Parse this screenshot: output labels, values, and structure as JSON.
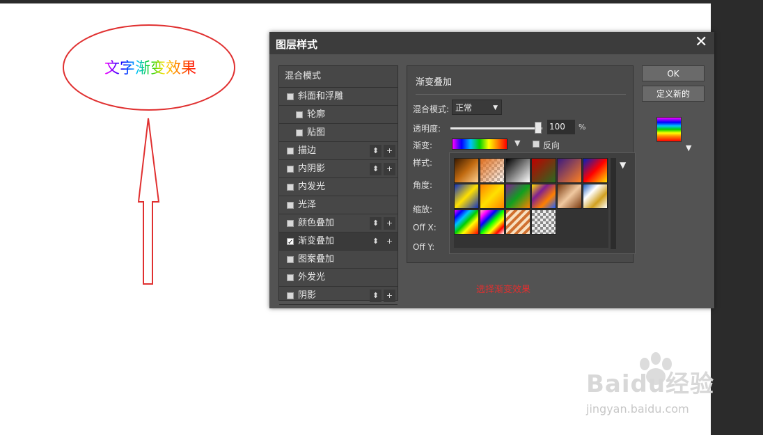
{
  "canvas_annotation": {
    "sample_text": "文字渐变效果",
    "caption": "选择渐变效果",
    "annotation_color": "#e03030"
  },
  "dialog": {
    "title": "图层样式",
    "close_glyph": "✕",
    "style_list": {
      "header": "混合模式",
      "items": [
        {
          "label": "斜面和浮雕",
          "checked": false,
          "indent": false,
          "has_buttons": false
        },
        {
          "label": "轮廓",
          "checked": false,
          "indent": true,
          "has_buttons": false
        },
        {
          "label": "贴图",
          "checked": false,
          "indent": true,
          "has_buttons": false
        },
        {
          "label": "描边",
          "checked": false,
          "indent": false,
          "has_buttons": true
        },
        {
          "label": "内阴影",
          "checked": false,
          "indent": false,
          "has_buttons": true
        },
        {
          "label": "内发光",
          "checked": false,
          "indent": false,
          "has_buttons": false
        },
        {
          "label": "光泽",
          "checked": false,
          "indent": false,
          "has_buttons": false
        },
        {
          "label": "颜色叠加",
          "checked": false,
          "indent": false,
          "has_buttons": true
        },
        {
          "label": "渐变叠加",
          "checked": true,
          "indent": false,
          "has_buttons": true,
          "active": true
        },
        {
          "label": "图案叠加",
          "checked": false,
          "indent": false,
          "has_buttons": false
        },
        {
          "label": "外发光",
          "checked": false,
          "indent": false,
          "has_buttons": false
        },
        {
          "label": "阴影",
          "checked": false,
          "indent": false,
          "has_buttons": true
        }
      ],
      "move_glyph": "⬍",
      "add_glyph": "+"
    },
    "panel": {
      "title": "渐变叠加",
      "blend_mode_label": "混合模式:",
      "blend_mode_value": "正常",
      "opacity_label": "透明度:",
      "opacity_value": "100",
      "opacity_fraction": 1.0,
      "opacity_unit": "%",
      "gradient_label": "渐变:",
      "reverse_label": "反向",
      "style_label": "样式:",
      "angle_label": "角度:",
      "scale_label": "缩放:",
      "offx_label": "Off X:",
      "offy_label": "Off Y:"
    },
    "gradient_picker": {
      "presets": [
        {
          "name": "copper"
        },
        {
          "name": "orange-transparent"
        },
        {
          "name": "black-white"
        },
        {
          "name": "red-green"
        },
        {
          "name": "violet-orange"
        },
        {
          "name": "blue-red-yellow"
        },
        {
          "name": "blue-yellow-blue"
        },
        {
          "name": "orange-yellow-orange"
        },
        {
          "name": "violet-green-orange"
        },
        {
          "name": "yellow-violet-orange-blue"
        },
        {
          "name": "copper-chrome"
        },
        {
          "name": "chrome"
        },
        {
          "name": "spectrum"
        },
        {
          "name": "transparent-rainbow"
        },
        {
          "name": "transparent-stripes"
        },
        {
          "name": "transparent-checker"
        }
      ]
    },
    "buttons": {
      "ok": "OK",
      "new_style": "定义新的"
    }
  },
  "watermark": {
    "logo": "Baidu经验",
    "url": "jingyan.baidu.com"
  },
  "colors": {
    "dialog_bg": "#535353",
    "titlebar": "#3c3c3c",
    "annotation_red": "#e03030"
  }
}
